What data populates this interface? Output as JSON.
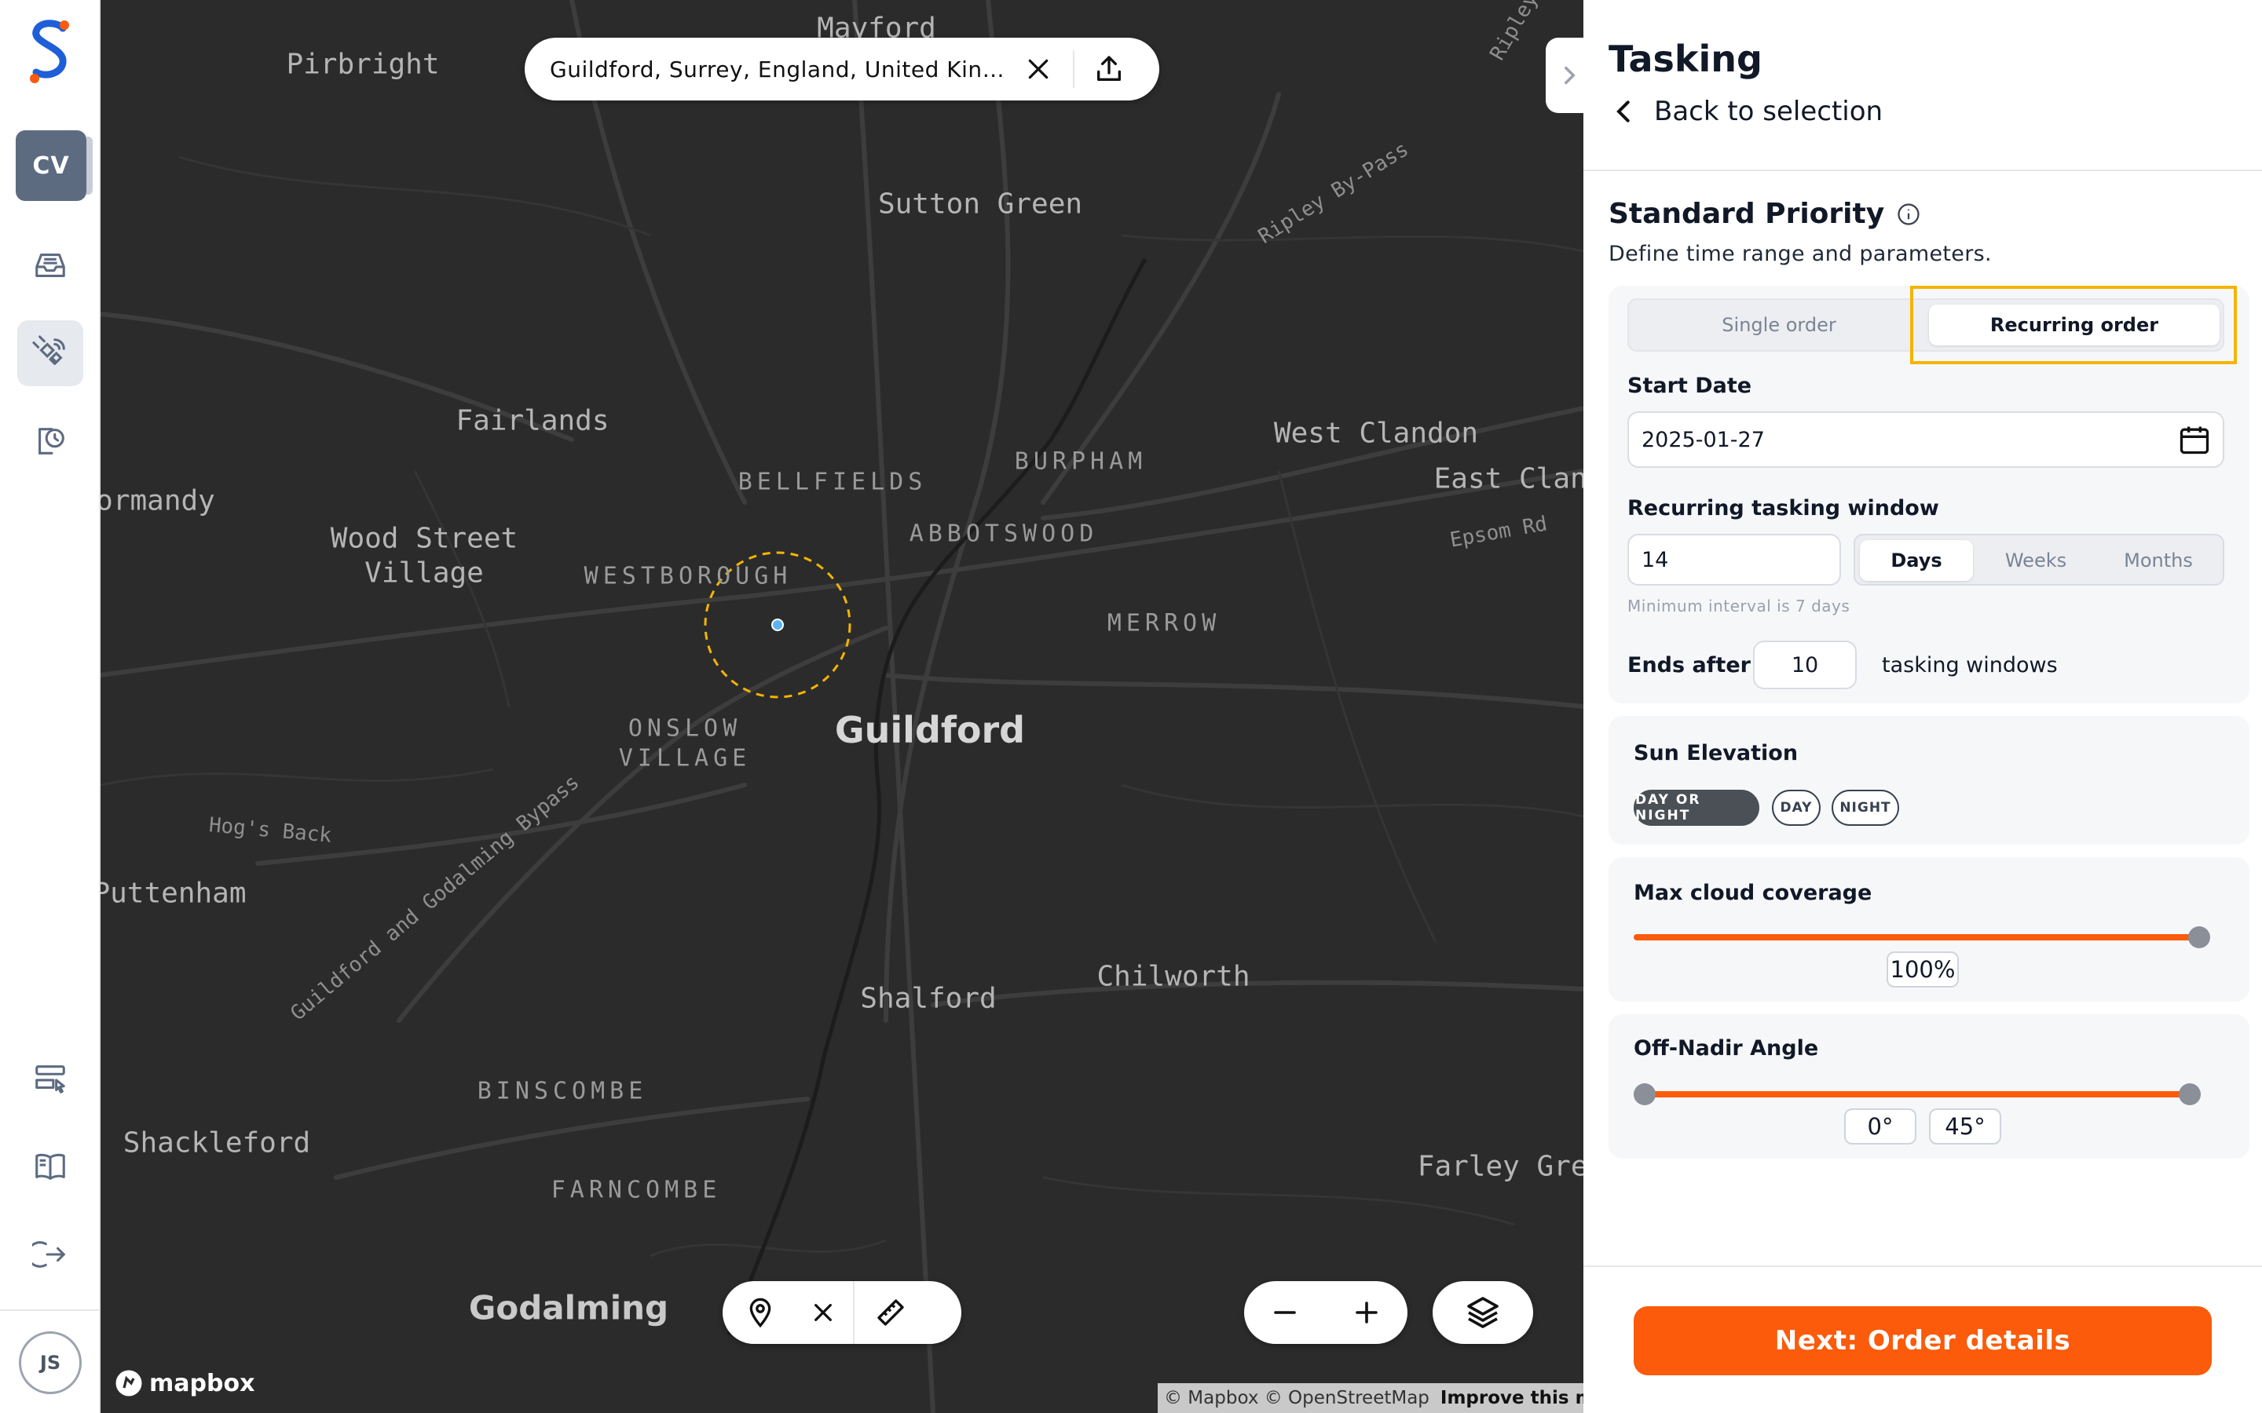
{
  "nav": {
    "workspace_initials": "CV",
    "user_initials": "JS",
    "icons": [
      "inbox-icon",
      "satellite-icon",
      "history-icon",
      "list-pointer-icon",
      "book-icon",
      "logout-icon"
    ],
    "accent": "#fb5b0a"
  },
  "map": {
    "search_value": "Guildford, Surrey, England, United Kingdom",
    "attribution": "© Mapbox © OpenStreetMap",
    "improve_link": "Improve this map",
    "logo_text": "mapbox",
    "places": {
      "mayford": "Mayford",
      "pirbright": "Pirbright",
      "sutton_green": "Sutton Green",
      "ripley_bypass": "Ripley By-Pass",
      "ripley": "Ripley",
      "fairlands": "Fairlands",
      "bellfields": "BELLFIELDS",
      "burpham": "BURPHAM",
      "west_clandon": "West Clandon",
      "east_clandon": "East Cland",
      "epsom_rd": "Epsom Rd",
      "normandy": "ormandy",
      "wood_street_1": "Wood Street",
      "wood_street_2": "Village",
      "westborough": "WESTBOROUGH",
      "abbotswood": "ABBOTSWOOD",
      "merrow": "MERROW",
      "onslow_1": "ONSLOW",
      "onslow_2": "VILLAGE",
      "guildford": "Guildford",
      "hogs_back": "Hog's Back",
      "bypass": "Guildford and Godalming Bypass",
      "puttenham": "Puttenham",
      "shalford": "Shalford",
      "chilworth": "Chilworth",
      "binscombe": "BINSCOMBE",
      "shackleford": "Shackleford",
      "farncombe": "FARNCOMBE",
      "farley_green": "Farley Gree",
      "godalming": "Godalming"
    }
  },
  "panel": {
    "title": "Tasking",
    "back_label": "Back to selection",
    "section_title": "Standard Priority",
    "section_subtitle": "Define time range and parameters.",
    "order_type": {
      "options": [
        "Single order",
        "Recurring order"
      ],
      "selected": "Recurring order"
    },
    "start_date": {
      "label": "Start Date",
      "value": "2025-01-27"
    },
    "window": {
      "label": "Recurring tasking window",
      "value": "14",
      "units": [
        "Days",
        "Weeks",
        "Months"
      ],
      "selected_unit": "Days",
      "hint": "Minimum interval is 7 days"
    },
    "ends_after": {
      "label": "Ends after",
      "value": "10",
      "suffix": "tasking windows"
    },
    "sun_elevation": {
      "label": "Sun Elevation",
      "options": [
        "DAY OR NIGHT",
        "DAY",
        "NIGHT"
      ],
      "selected": "DAY OR NIGHT"
    },
    "cloud": {
      "label": "Max cloud coverage",
      "value": 100,
      "display": "100%"
    },
    "off_nadir": {
      "label": "Off-Nadir Angle",
      "min": 0,
      "max": 45,
      "min_display": "0°",
      "max_display": "45°"
    },
    "next_label": "Next: Order details"
  }
}
